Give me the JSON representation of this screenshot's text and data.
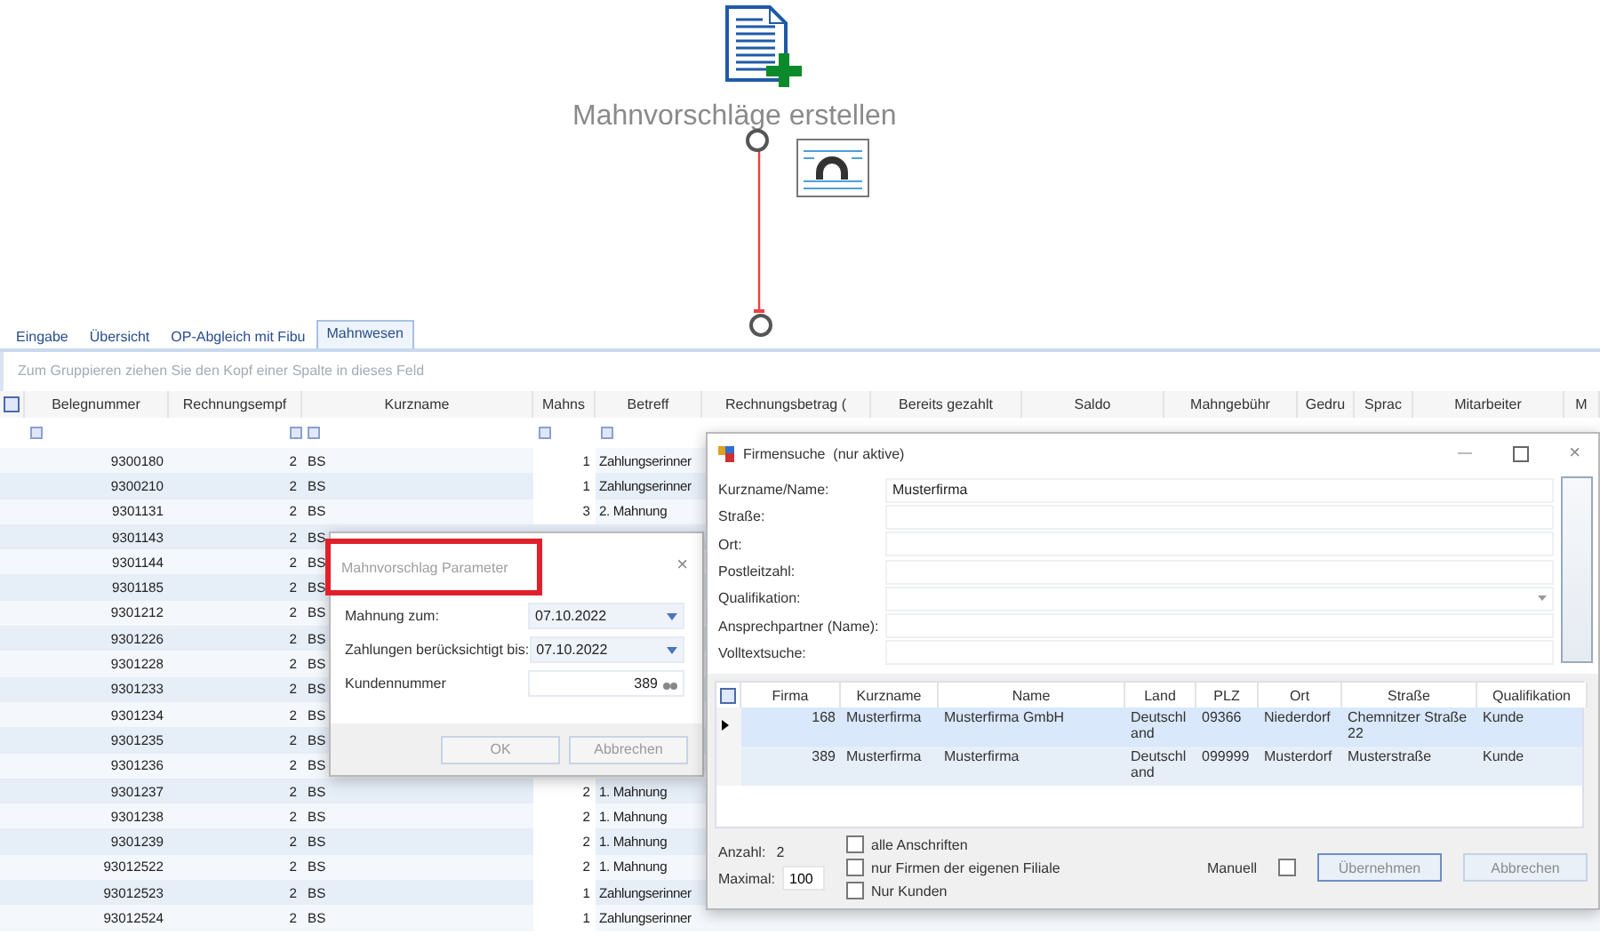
{
  "canvas": {
    "action_label": "Mahnvorschläge erstellen"
  },
  "tabs": [
    {
      "label": "Eingabe",
      "selected": false
    },
    {
      "label": "Übersicht",
      "selected": false
    },
    {
      "label": "OP-Abgleich mit Fibu",
      "selected": false
    },
    {
      "label": "Mahnwesen",
      "selected": true
    }
  ],
  "group_panel_hint": "Zum Gruppieren ziehen Sie den Kopf einer Spalte in dieses Feld",
  "grid": {
    "columns": [
      "Belegnummer",
      "Rechnungsempf",
      "Kurzname",
      "Mahns",
      "Betreff",
      "Rechnungsbetrag (",
      "Bereits gezahlt",
      "Saldo",
      "Mahngebühr",
      "Gedru",
      "Sprac",
      "Mitarbeiter",
      "M"
    ],
    "rows": [
      {
        "belegnummer": "9300180",
        "rechnungsempf": "2",
        "kurzname": "BS",
        "mahnstufe": "1",
        "betreff": "Zahlungserinner"
      },
      {
        "belegnummer": "9300210",
        "rechnungsempf": "2",
        "kurzname": "BS",
        "mahnstufe": "1",
        "betreff": "Zahlungserinner"
      },
      {
        "belegnummer": "9301131",
        "rechnungsempf": "2",
        "kurzname": "BS",
        "mahnstufe": "3",
        "betreff": "2. Mahnung"
      },
      {
        "belegnummer": "9301143",
        "rechnungsempf": "2",
        "kurzname": "BS"
      },
      {
        "belegnummer": "9301144",
        "rechnungsempf": "2",
        "kurzname": "BS"
      },
      {
        "belegnummer": "9301185",
        "rechnungsempf": "2",
        "kurzname": "BS"
      },
      {
        "belegnummer": "9301212",
        "rechnungsempf": "2",
        "kurzname": "BS"
      },
      {
        "belegnummer": "9301226",
        "rechnungsempf": "2",
        "kurzname": "BS"
      },
      {
        "belegnummer": "9301228",
        "rechnungsempf": "2",
        "kurzname": "BS"
      },
      {
        "belegnummer": "9301233",
        "rechnungsempf": "2",
        "kurzname": "BS"
      },
      {
        "belegnummer": "9301234",
        "rechnungsempf": "2",
        "kurzname": "BS"
      },
      {
        "belegnummer": "9301235",
        "rechnungsempf": "2",
        "kurzname": "BS"
      },
      {
        "belegnummer": "9301236",
        "rechnungsempf": "2",
        "kurzname": "BS"
      },
      {
        "belegnummer": "9301237",
        "rechnungsempf": "2",
        "kurzname": "BS",
        "mahnstufe": "2",
        "betreff": "1. Mahnung"
      },
      {
        "belegnummer": "9301238",
        "rechnungsempf": "2",
        "kurzname": "BS",
        "mahnstufe": "2",
        "betreff": "1. Mahnung"
      },
      {
        "belegnummer": "9301239",
        "rechnungsempf": "2",
        "kurzname": "BS",
        "mahnstufe": "2",
        "betreff": "1. Mahnung"
      },
      {
        "belegnummer": "93012522",
        "rechnungsempf": "2",
        "kurzname": "BS",
        "mahnstufe": "2",
        "betreff": "1. Mahnung"
      },
      {
        "belegnummer": "93012523",
        "rechnungsempf": "2",
        "kurzname": "BS",
        "mahnstufe": "1",
        "betreff": "Zahlungserinner"
      },
      {
        "belegnummer": "93012524",
        "rechnungsempf": "2",
        "kurzname": "BS",
        "mahnstufe": "1",
        "betreff": "Zahlungserinner"
      }
    ]
  },
  "parameter_dialog": {
    "title": "Mahnvorschlag Parameter",
    "close": "×",
    "fields": [
      {
        "label": "Mahnung zum:",
        "value": "07.10.2022",
        "kind": "dropdown"
      },
      {
        "label": "Zahlungen berücksichtigt bis:",
        "value": "07.10.2022",
        "kind": "dropdown"
      },
      {
        "label": "Kundennummer",
        "value": "389",
        "kind": "lookup"
      }
    ],
    "buttons": [
      "OK",
      "Abbrechen"
    ]
  },
  "company_search": {
    "title": "Firmensuche  (nur aktive)",
    "close": "×",
    "fields": [
      {
        "label": "Kurzname/Name:",
        "value": "Musterfirma",
        "kind": "text"
      },
      {
        "label": "Straße:",
        "kind": "text"
      },
      {
        "label": "Ort:",
        "kind": "text"
      },
      {
        "label": "Postleitzahl:",
        "kind": "text"
      },
      {
        "label": "Qualifikation:",
        "kind": "dropdown"
      },
      {
        "label": "Ansprechpartner (Name):",
        "kind": "text"
      },
      {
        "label": "Volltextsuche:",
        "kind": "text"
      }
    ],
    "columns": [
      "Firma",
      "Kurzname",
      "Name",
      "Land",
      "PLZ",
      "Ort",
      "Straße",
      "Qualifikation"
    ],
    "rows": [
      {
        "selected": true,
        "cells": [
          "168",
          "Musterfirma",
          "Musterfirma GmbH",
          "Deutschland",
          "09366",
          "Niederdorf",
          "Chemnitzer Straße 22",
          "Kunde"
        ]
      },
      {
        "selected": false,
        "cells": [
          "389",
          "Musterfirma",
          "Musterfirma",
          "Deutschland",
          "099999",
          "Musterdorf",
          "Musterstraße",
          "Kunde"
        ]
      }
    ],
    "count_label": "Anzahl:",
    "count": "2",
    "max_label": "Maximal:",
    "max": "100",
    "options": [
      {
        "label": "alle Anschriften",
        "checked": false
      },
      {
        "label": "nur Firmen der eigenen Filiale",
        "checked": false
      },
      {
        "label": "Nur Kunden",
        "checked": false
      }
    ],
    "manual": {
      "label": "Manuell",
      "checked": false
    },
    "buttons": [
      "Übernehmen",
      "Abbrechen"
    ]
  }
}
